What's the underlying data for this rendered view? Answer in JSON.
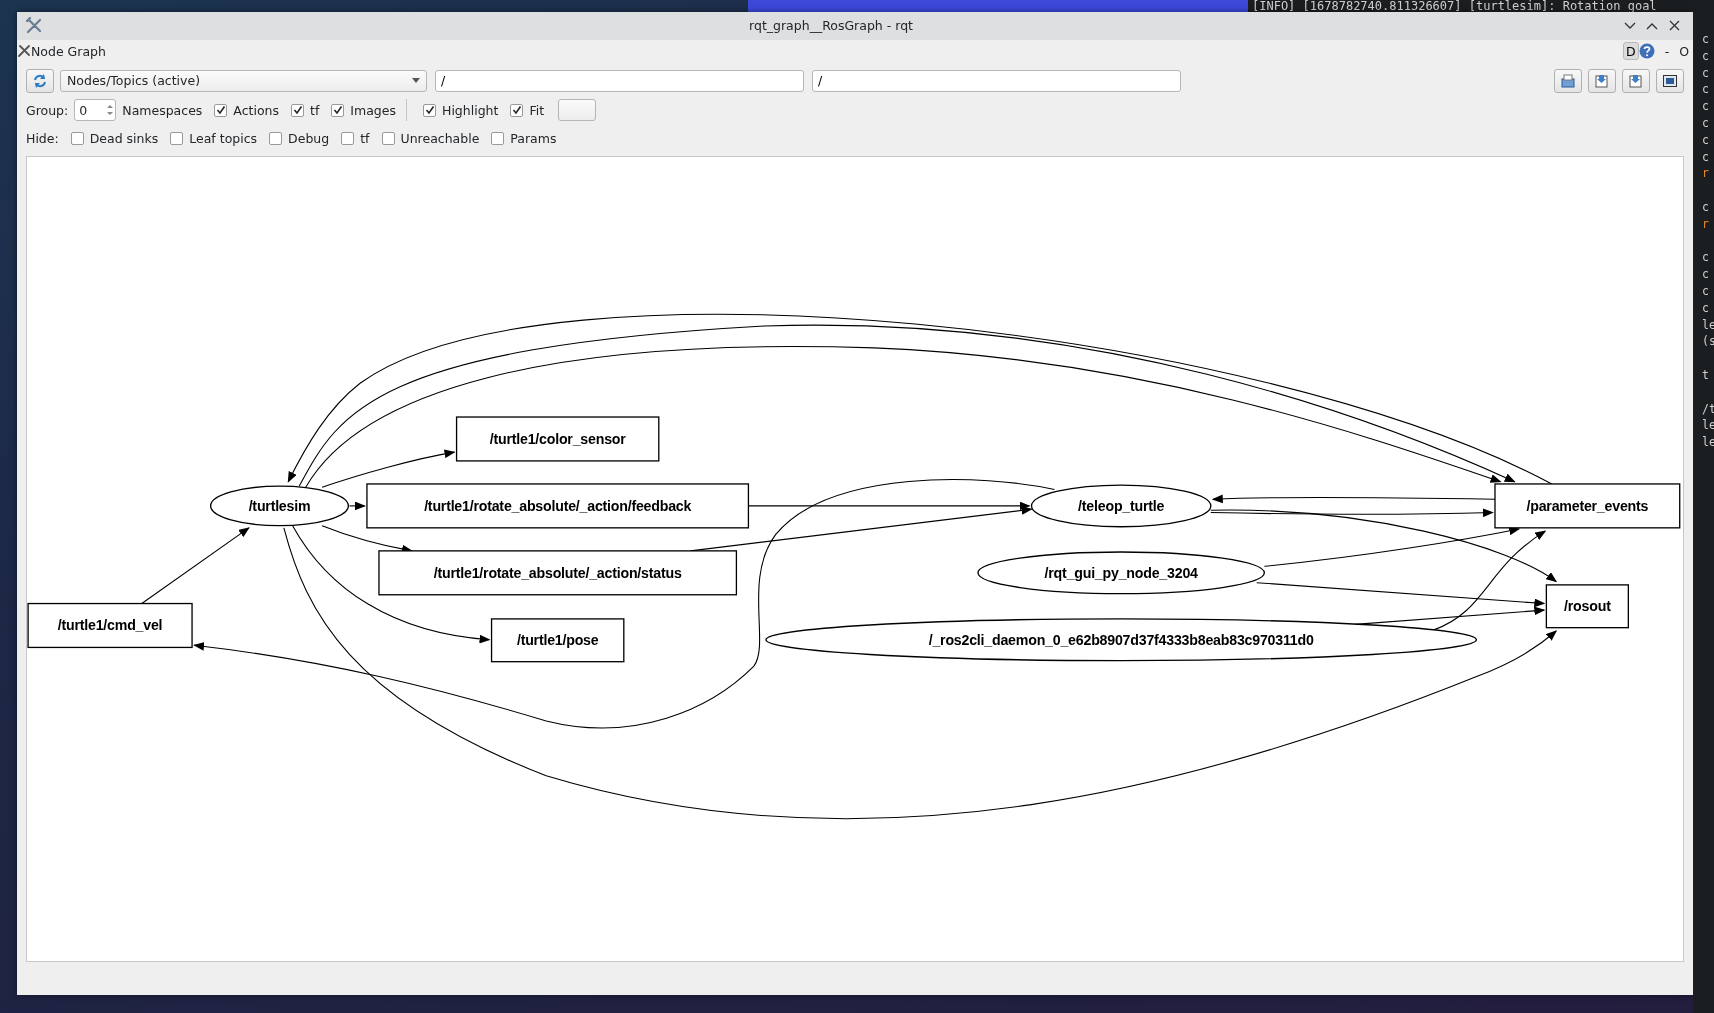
{
  "terminal": {
    "header": "[INFO] [1678782740.811326607] [turtlesim]: Rotation goal",
    "lines": [
      {
        "text": "c",
        "kind": "plain",
        "blank_before": false
      },
      {
        "text": "c",
        "kind": "plain",
        "blank_before": false
      },
      {
        "text": "c",
        "kind": "plain",
        "blank_before": false
      },
      {
        "text": "c",
        "kind": "plain",
        "blank_before": false
      },
      {
        "text": "c",
        "kind": "plain",
        "blank_before": false
      },
      {
        "text": "c",
        "kind": "plain",
        "blank_before": false
      },
      {
        "text": "c",
        "kind": "plain",
        "blank_before": false
      },
      {
        "text": "c",
        "kind": "plain",
        "blank_before": false
      },
      {
        "text": "r",
        "kind": "warn",
        "blank_before": false
      },
      {
        "text": "c",
        "kind": "plain",
        "blank_before": true
      },
      {
        "text": "r",
        "kind": "warn",
        "blank_before": false
      },
      {
        "text": "c",
        "kind": "plain",
        "blank_before": true
      },
      {
        "text": "c",
        "kind": "plain",
        "blank_before": false
      },
      {
        "text": "c",
        "kind": "plain",
        "blank_before": false
      },
      {
        "text": "c",
        "kind": "plain",
        "blank_before": false
      },
      {
        "text": "le",
        "kind": "plain",
        "blank_before": false
      },
      {
        "text": "(s",
        "kind": "plain",
        "blank_before": false
      },
      {
        "text": "t",
        "kind": "plain",
        "blank_before": true
      },
      {
        "text": "/t",
        "kind": "plain",
        "blank_before": true
      },
      {
        "text": "le",
        "kind": "plain",
        "blank_before": false
      },
      {
        "text": "le",
        "kind": "plain",
        "blank_before": false
      }
    ]
  },
  "window": {
    "title": "rqt_graph__RosGraph - rqt"
  },
  "dock": {
    "title": "Node Graph",
    "d_button": "D",
    "minus": "-",
    "restore": "O"
  },
  "toolbar": {
    "graph_type": "Nodes/Topics (active)",
    "filters": [
      "/",
      "/"
    ],
    "group_label": "Group:",
    "group_value": "0",
    "namespaces_label": "Namespaces",
    "options": [
      {
        "label": "Actions",
        "checked": true
      },
      {
        "label": "tf",
        "checked": true
      },
      {
        "label": "Images",
        "checked": true
      }
    ],
    "view_options": [
      {
        "label": "Highlight",
        "checked": true
      },
      {
        "label": "Fit",
        "checked": true
      }
    ],
    "hide_label": "Hide:",
    "hide": [
      {
        "label": "Dead sinks",
        "checked": false
      },
      {
        "label": "Leaf topics",
        "checked": false
      },
      {
        "label": "Debug",
        "checked": false
      },
      {
        "label": "tf",
        "checked": false
      },
      {
        "label": "Unreachable",
        "checked": false
      },
      {
        "label": "Params",
        "checked": false
      }
    ]
  },
  "graph": {
    "nodes": [
      {
        "label": "/turtlesim",
        "kind": "node"
      },
      {
        "label": "/turtle1/color_sensor",
        "kind": "topic"
      },
      {
        "label": "/turtle1/rotate_absolute/_action/feedback",
        "kind": "topic"
      },
      {
        "label": "/turtle1/rotate_absolute/_action/status",
        "kind": "topic"
      },
      {
        "label": "/turtle1/pose",
        "kind": "topic"
      },
      {
        "label": "/turtle1/cmd_vel",
        "kind": "topic"
      },
      {
        "label": "/teleop_turtle",
        "kind": "node"
      },
      {
        "label": "/rqt_gui_py_node_3204",
        "kind": "node"
      },
      {
        "label": "/_ros2cli_daemon_0_e62b8907d37f4333b8eab83c970311d0",
        "kind": "node"
      },
      {
        "label": "/parameter_events",
        "kind": "topic"
      },
      {
        "label": "/rosout",
        "kind": "topic"
      }
    ]
  }
}
